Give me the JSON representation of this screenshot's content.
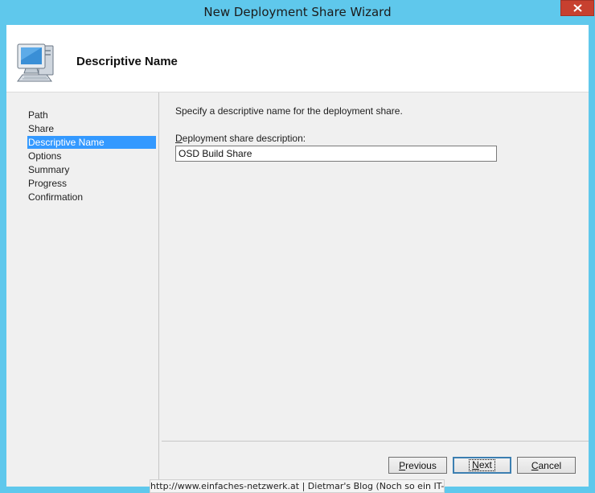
{
  "window": {
    "title": "New Deployment Share Wizard",
    "close_icon": "close-icon"
  },
  "header": {
    "icon": "computer-icon",
    "title": "Descriptive Name"
  },
  "nav": {
    "items": [
      {
        "label": "Path",
        "active": false
      },
      {
        "label": "Share",
        "active": false
      },
      {
        "label": "Descriptive Name",
        "active": true
      },
      {
        "label": "Options",
        "active": false
      },
      {
        "label": "Summary",
        "active": false
      },
      {
        "label": "Progress",
        "active": false
      },
      {
        "label": "Confirmation",
        "active": false
      }
    ]
  },
  "content": {
    "instruction": "Specify a descriptive name for the deployment share.",
    "field_label_accel": "D",
    "field_label_rest": "eployment share description:",
    "field_value": "OSD Build Share"
  },
  "buttons": {
    "previous_accel": "P",
    "previous_rest": "revious",
    "next_accel": "N",
    "next_rest": "ext",
    "cancel_accel": "C",
    "cancel_rest": "ancel"
  },
  "watermark": "http://www.einfaches-netzwerk.at | Dietmar's Blog (Noch so ein IT-Blog)"
}
